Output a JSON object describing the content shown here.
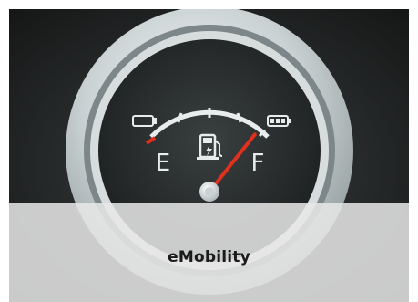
{
  "card": {
    "title": "eMobility"
  },
  "gauge": {
    "empty_label": "E",
    "full_label": "F",
    "level_percent": 85,
    "icons": [
      "battery-empty-icon",
      "fuel-pump-electric-icon",
      "battery-full-icon"
    ],
    "needle_color": "#e0301e",
    "empty_mark_color": "#e0301e"
  }
}
